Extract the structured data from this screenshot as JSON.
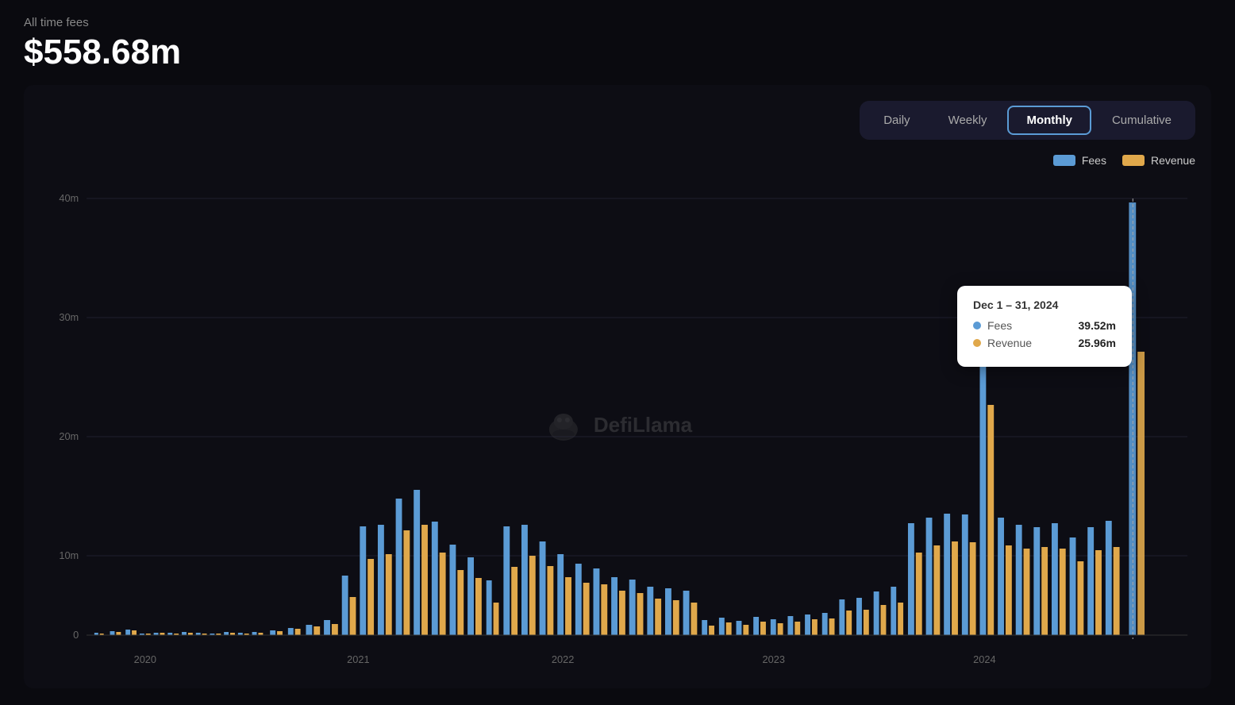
{
  "header": {
    "all_time_label": "All time fees",
    "total_value": "$558.68m"
  },
  "time_filters": {
    "buttons": [
      "Daily",
      "Weekly",
      "Monthly",
      "Cumulative"
    ],
    "active": "Monthly"
  },
  "legend": {
    "fees_label": "Fees",
    "revenue_label": "Revenue"
  },
  "tooltip": {
    "date": "Dec 1 – 31, 2024",
    "fees_label": "Fees",
    "fees_value": "39.52m",
    "revenue_label": "Revenue",
    "revenue_value": "25.96m"
  },
  "chart": {
    "y_axis_labels": [
      "40m",
      "30m",
      "20m",
      "10m",
      "0"
    ],
    "x_axis_labels": [
      "2020",
      "2021",
      "2022",
      "2023",
      "2024"
    ],
    "watermark_text": "DefiLlama"
  },
  "colors": {
    "fees_bar": "#5b9bd5",
    "revenue_bar": "#e0a84b",
    "active_btn_border": "#5b9bd5",
    "background": "#0a0a0f",
    "chart_bg": "#0d0d14",
    "grid_line": "#1e1e2e"
  }
}
